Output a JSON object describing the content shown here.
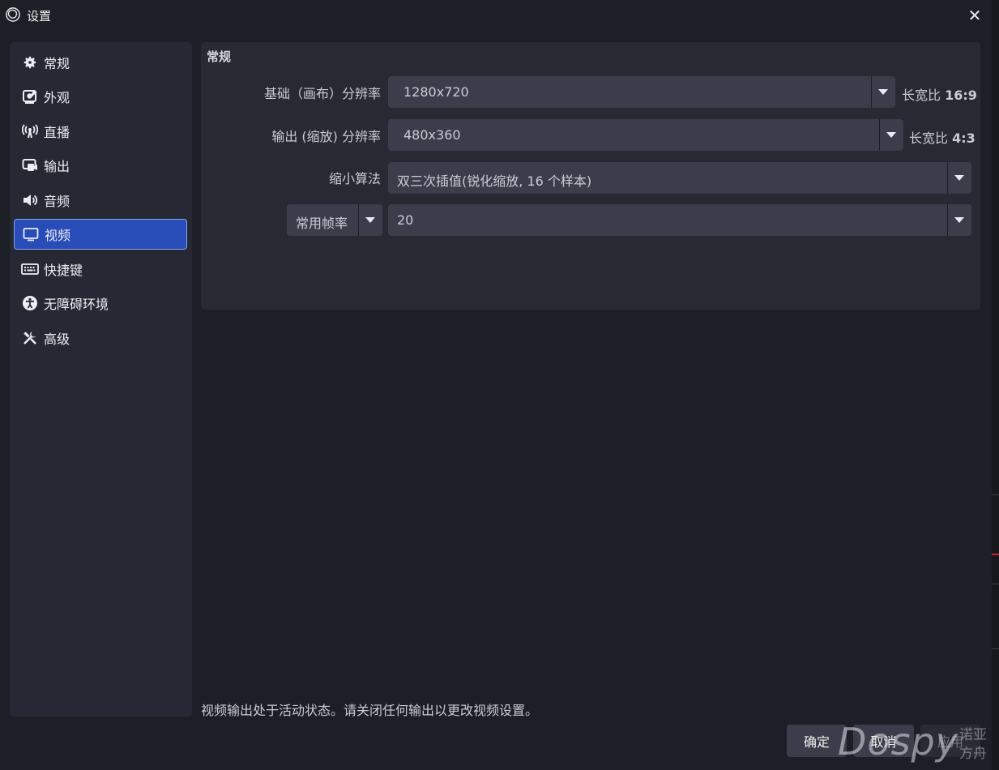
{
  "window": {
    "title": "设置",
    "close_glyph": "✕"
  },
  "sidebar": {
    "items": [
      {
        "label": "常规",
        "icon": "gear-icon"
      },
      {
        "label": "外观",
        "icon": "appearance-icon"
      },
      {
        "label": "直播",
        "icon": "antenna-icon"
      },
      {
        "label": "输出",
        "icon": "output-icon"
      },
      {
        "label": "音频",
        "icon": "speaker-icon"
      },
      {
        "label": "视频",
        "icon": "monitor-icon",
        "active": true
      },
      {
        "label": "快捷键",
        "icon": "keyboard-icon"
      },
      {
        "label": "无障碍环境",
        "icon": "accessibility-icon"
      },
      {
        "label": "高级",
        "icon": "tools-icon"
      }
    ]
  },
  "panel": {
    "title": "常规",
    "base_resolution": {
      "label": "基础（画布）分辨率",
      "value": "1280x720",
      "aspect_prefix": "长宽比",
      "aspect_value": "16:9"
    },
    "output_resolution": {
      "label": "输出 (缩放) 分辨率",
      "value": "480x360",
      "aspect_prefix": "长宽比",
      "aspect_value": "4:3"
    },
    "downscale_filter": {
      "label": "缩小算法",
      "value": "双三次插值(锐化缩放, 16 个样本)"
    },
    "fps": {
      "type_value": "常用帧率",
      "value": "20"
    }
  },
  "notice": "视频输出处于活动状态。请关闭任何输出以更改视频设置。",
  "buttons": {
    "ok": "确定",
    "cancel": "取消",
    "apply": "应用"
  },
  "watermark": {
    "text": "Dospy",
    "cn_line1": "诺亚",
    "cn_line2": "方舟"
  },
  "colors": {
    "accent": "#284cb8",
    "background": "#1d1f26",
    "panel": "#272a33"
  }
}
